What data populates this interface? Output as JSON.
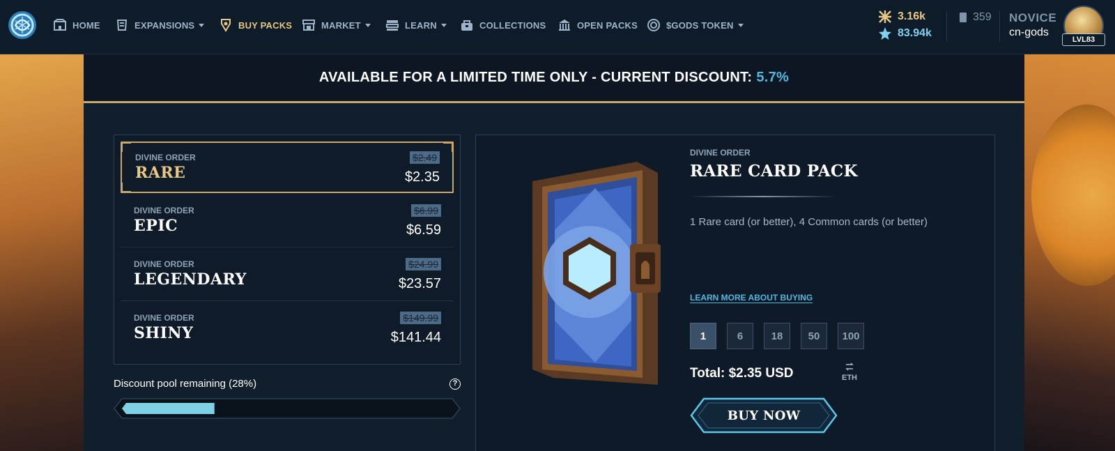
{
  "nav": {
    "items": [
      {
        "label": "HOME",
        "icon": "home-icon"
      },
      {
        "label": "EXPANSIONS",
        "icon": "expansions-icon"
      },
      {
        "label": "BUY PACKS",
        "icon": "buy-packs-icon"
      },
      {
        "label": "MARKET",
        "icon": "market-icon"
      },
      {
        "label": "LEARN",
        "icon": "learn-icon"
      },
      {
        "label": "COLLECTIONS",
        "icon": "collections-icon"
      },
      {
        "label": "OPEN PACKS",
        "icon": "open-packs-icon"
      },
      {
        "label": "$GODS TOKEN",
        "icon": "gods-token-icon"
      }
    ],
    "active": "BUY PACKS"
  },
  "user": {
    "flux": "3.16k",
    "star": "83.94k",
    "cards": "359",
    "rank": "NOVICE",
    "name": "cn-gods",
    "level": "LVL83"
  },
  "banner": {
    "text": "AVAILABLE FOR A LIMITED TIME ONLY - CURRENT DISCOUNT:",
    "discount": "5.7%"
  },
  "packs": [
    {
      "category": "DIVINE ORDER",
      "name": "RARE",
      "old_price": "$2.49",
      "price": "$2.35"
    },
    {
      "category": "DIVINE ORDER",
      "name": "EPIC",
      "old_price": "$6.99",
      "price": "$6.59"
    },
    {
      "category": "DIVINE ORDER",
      "name": "LEGENDARY",
      "old_price": "$24.99",
      "price": "$23.57"
    },
    {
      "category": "DIVINE ORDER",
      "name": "SHINY",
      "old_price": "$149.99",
      "price": "$141.44"
    }
  ],
  "pool": {
    "label": "Discount pool remaining (28%)",
    "help": "?",
    "fraction": 0.28
  },
  "detail": {
    "category": "DIVINE ORDER",
    "title": "RARE CARD PACK",
    "description": "1 Rare card (or better), 4 Common cards (or better)",
    "learn_more": "LEARN MORE ABOUT BUYING",
    "quantities": [
      "1",
      "6",
      "18",
      "50",
      "100"
    ],
    "selected_quantity": "1",
    "total": "Total: $2.35 USD",
    "currency_toggle": "ETH",
    "buy_label": "BUY NOW"
  },
  "colors": {
    "accent_gold": "#c9a86a",
    "accent_blue": "#4fb8e0",
    "nav_bg": "#0e1b29"
  }
}
